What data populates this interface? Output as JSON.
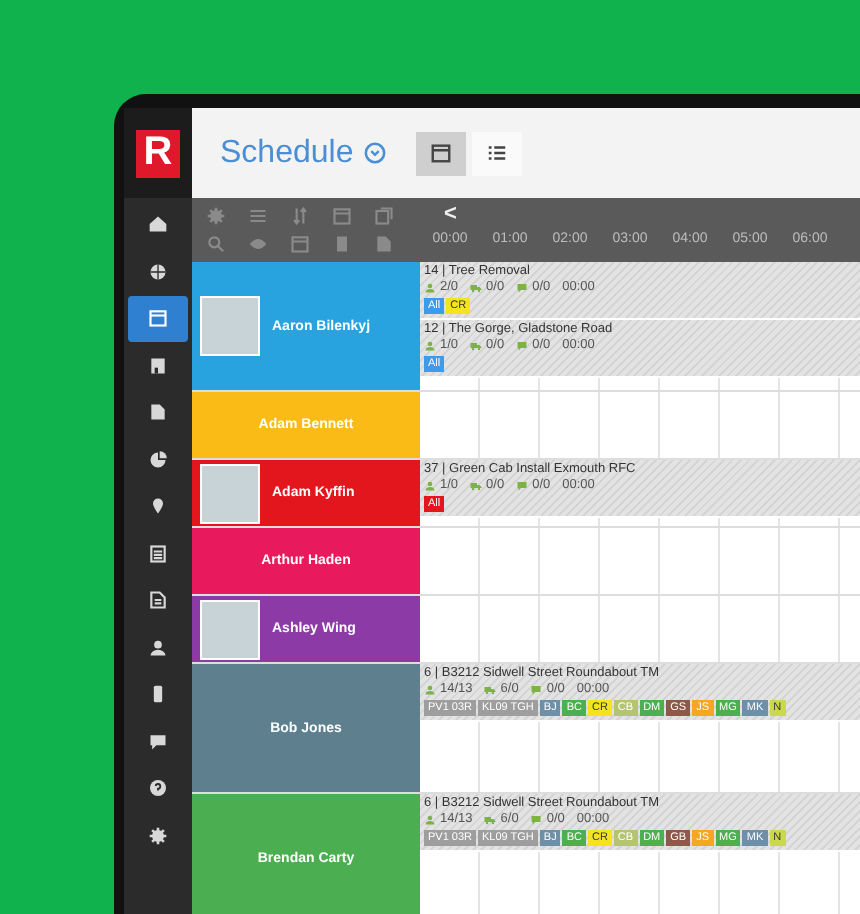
{
  "logo": "R",
  "sidebar": {
    "items": [
      {
        "kind": "home",
        "selected": false
      },
      {
        "kind": "globe",
        "selected": false
      },
      {
        "kind": "calendar",
        "selected": true
      },
      {
        "kind": "building",
        "selected": false
      },
      {
        "kind": "document",
        "selected": false
      },
      {
        "kind": "pie",
        "selected": false
      },
      {
        "kind": "pin",
        "selected": false
      },
      {
        "kind": "form",
        "selected": false
      },
      {
        "kind": "file",
        "selected": false
      },
      {
        "kind": "person",
        "selected": false
      },
      {
        "kind": "phone",
        "selected": false
      },
      {
        "kind": "chat",
        "selected": false
      },
      {
        "kind": "help",
        "selected": false
      },
      {
        "kind": "gear",
        "selected": false
      }
    ]
  },
  "header": {
    "title": "Schedule",
    "views": [
      {
        "kind": "calendar",
        "selected": true
      },
      {
        "kind": "list",
        "selected": false
      }
    ]
  },
  "toolbar": {
    "back": "<",
    "hours": [
      "00:00",
      "01:00",
      "02:00",
      "03:00",
      "04:00",
      "05:00",
      "06:00"
    ]
  },
  "rows": [
    {
      "name": "Aaron Bilenkyj",
      "color": "#29a3df",
      "photo": true,
      "jobs": [
        {
          "title": "14 | Tree Removal",
          "stats": [
            "2/0",
            "0/0",
            "0/0",
            "00:00"
          ],
          "tags": [
            {
              "text": "All",
              "color": "#3d9be9"
            },
            {
              "text": "CR",
              "color": "#f3e41d"
            }
          ]
        },
        {
          "title": "12 | The Gorge, Gladstone Road",
          "stats": [
            "1/0",
            "0/0",
            "0/0",
            "00:00"
          ],
          "tags": [
            {
              "text": "All",
              "color": "#3d9be9"
            }
          ]
        }
      ]
    },
    {
      "name": "Adam Bennett",
      "color": "#fbbb16",
      "photo": false,
      "jobs": []
    },
    {
      "name": "Adam Kyffin",
      "color": "#e3161d",
      "photo": true,
      "jobs": [
        {
          "title": "37 | Green Cab Install Exmouth RFC",
          "stats": [
            "1/0",
            "0/0",
            "0/0",
            "00:00"
          ],
          "tags": [
            {
              "text": "All",
              "color": "#e3161d"
            }
          ]
        }
      ]
    },
    {
      "name": "Arthur Haden",
      "color": "#e8195d",
      "photo": false,
      "jobs": []
    },
    {
      "name": "Ashley Wing",
      "color": "#8c3ba6",
      "photo": true,
      "jobs": []
    },
    {
      "name": "Bob Jones",
      "color": "#5e7f8d",
      "photo": false,
      "jobs": [
        {
          "title": "6 | B3212 Sidwell Street Roundabout TM",
          "stats": [
            "14/13",
            "6/0",
            "0/0",
            "00:00"
          ],
          "tags": [
            {
              "text": "PV1 03R",
              "color": "#9e9e9e"
            },
            {
              "text": "KL09 TGH",
              "color": "#9e9e9e"
            },
            {
              "text": "BJ",
              "color": "#6d8fa8"
            },
            {
              "text": "BC",
              "color": "#4caf50"
            },
            {
              "text": "CR",
              "color": "#f3e41d"
            },
            {
              "text": "CB",
              "color": "#b5c470"
            },
            {
              "text": "DM",
              "color": "#4caf50"
            },
            {
              "text": "GS",
              "color": "#8d5a4a"
            },
            {
              "text": "JS",
              "color": "#f5a623"
            },
            {
              "text": "MG",
              "color": "#4caf50"
            },
            {
              "text": "MK",
              "color": "#6d8fa8"
            },
            {
              "text": "N",
              "color": "#c9d94a"
            }
          ]
        }
      ]
    },
    {
      "name": "Brendan Carty",
      "color": "#4bae50",
      "photo": false,
      "jobs": [
        {
          "title": "6 | B3212 Sidwell Street Roundabout TM",
          "stats": [
            "14/13",
            "6/0",
            "0/0",
            "00:00"
          ],
          "tags": [
            {
              "text": "PV1 03R",
              "color": "#9e9e9e"
            },
            {
              "text": "KL09 TGH",
              "color": "#9e9e9e"
            },
            {
              "text": "BJ",
              "color": "#6d8fa8"
            },
            {
              "text": "BC",
              "color": "#4caf50"
            },
            {
              "text": "CR",
              "color": "#f3e41d"
            },
            {
              "text": "CB",
              "color": "#b5c470"
            },
            {
              "text": "DM",
              "color": "#4caf50"
            },
            {
              "text": "GB",
              "color": "#8d5a4a"
            },
            {
              "text": "JS",
              "color": "#f5a623"
            },
            {
              "text": "MG",
              "color": "#4caf50"
            },
            {
              "text": "MK",
              "color": "#6d8fa8"
            },
            {
              "text": "N",
              "color": "#c9d94a"
            }
          ]
        }
      ]
    }
  ]
}
